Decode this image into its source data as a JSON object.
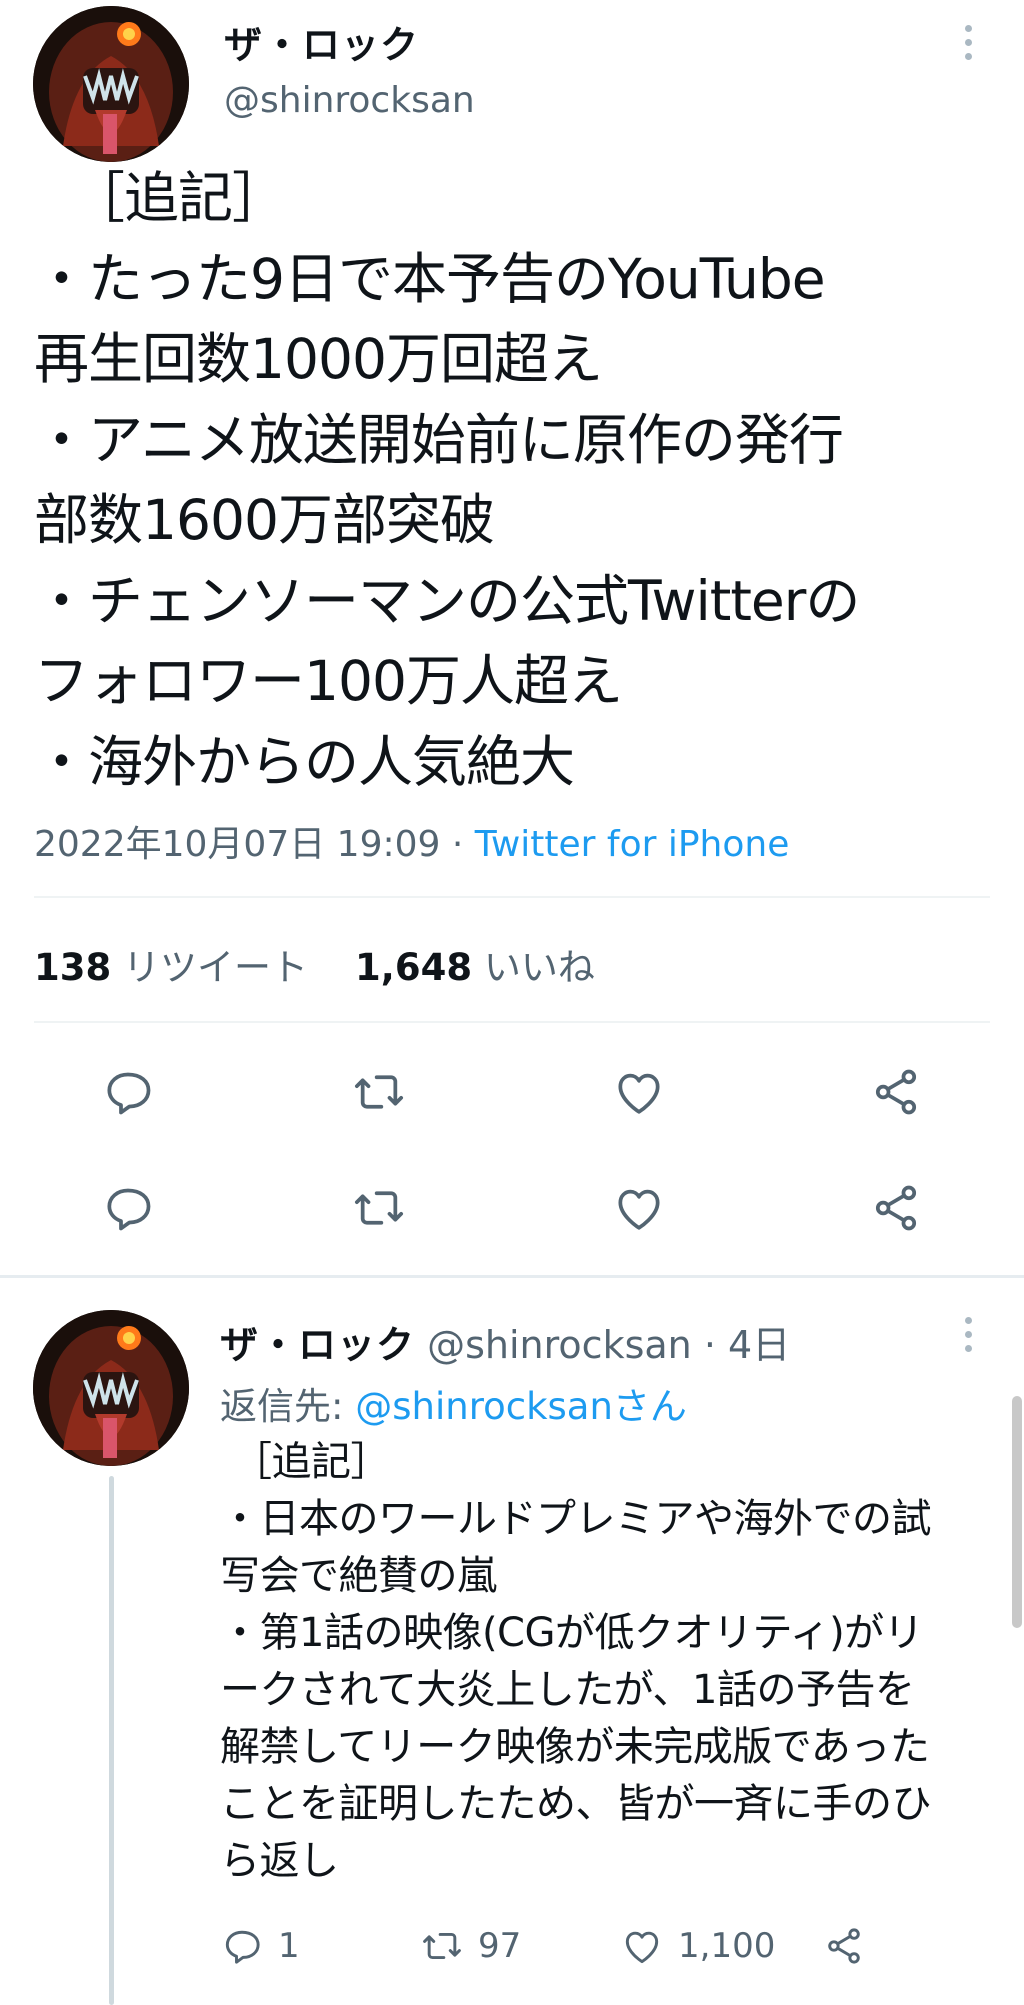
{
  "main_tweet": {
    "author_name": "ザ・ロック",
    "author_handle": "@shinrocksan",
    "text_lines": [
      "［追記］",
      "・たった9日で本予告のYouTube",
      "再生回数1000万回超え",
      "・アニメ放送開始前に原作の発行",
      "部数1600万部突破",
      "・チェンソーマンの公式Twitterの",
      "フォロワー100万人超え",
      "・海外からの人気絶大"
    ],
    "timestamp": "2022年10月07日 19:09",
    "separator": "·",
    "source": "Twitter for iPhone",
    "retweet_count": "138",
    "retweet_label": "リツイート",
    "like_count": "1,648",
    "like_label": "いいね"
  },
  "icons": {
    "reply": "reply-icon",
    "retweet": "retweet-icon",
    "like": "heart-icon",
    "share": "share-icon",
    "more": "more-vertical-icon",
    "icon_color": "#536471"
  },
  "reply_tweet": {
    "author_name": "ザ・ロック",
    "author_handle": "@shinrocksan",
    "time_sep": "·",
    "time_ago": "4日",
    "reply_to_label": "返信先:",
    "reply_to_mention": "@shinrocksanさん",
    "text_lines": [
      "［追記］",
      "・日本のワールドプレミアや海外での試",
      "写会で絶賛の嵐",
      "・第1話の映像(CGが低クオリティ)がリ",
      "ークされて大炎上したが、1話の予告を",
      "解禁してリーク映像が未完成版であった",
      "ことを証明したため、皆が一斉に手のひ",
      "ら返し"
    ],
    "reply_count": "1",
    "retweet_count": "97",
    "like_count": "1,100"
  },
  "colors": {
    "text_primary": "#0f1419",
    "text_secondary": "#536471",
    "accent": "#1d9bf0",
    "divider": "#eff3f4"
  }
}
